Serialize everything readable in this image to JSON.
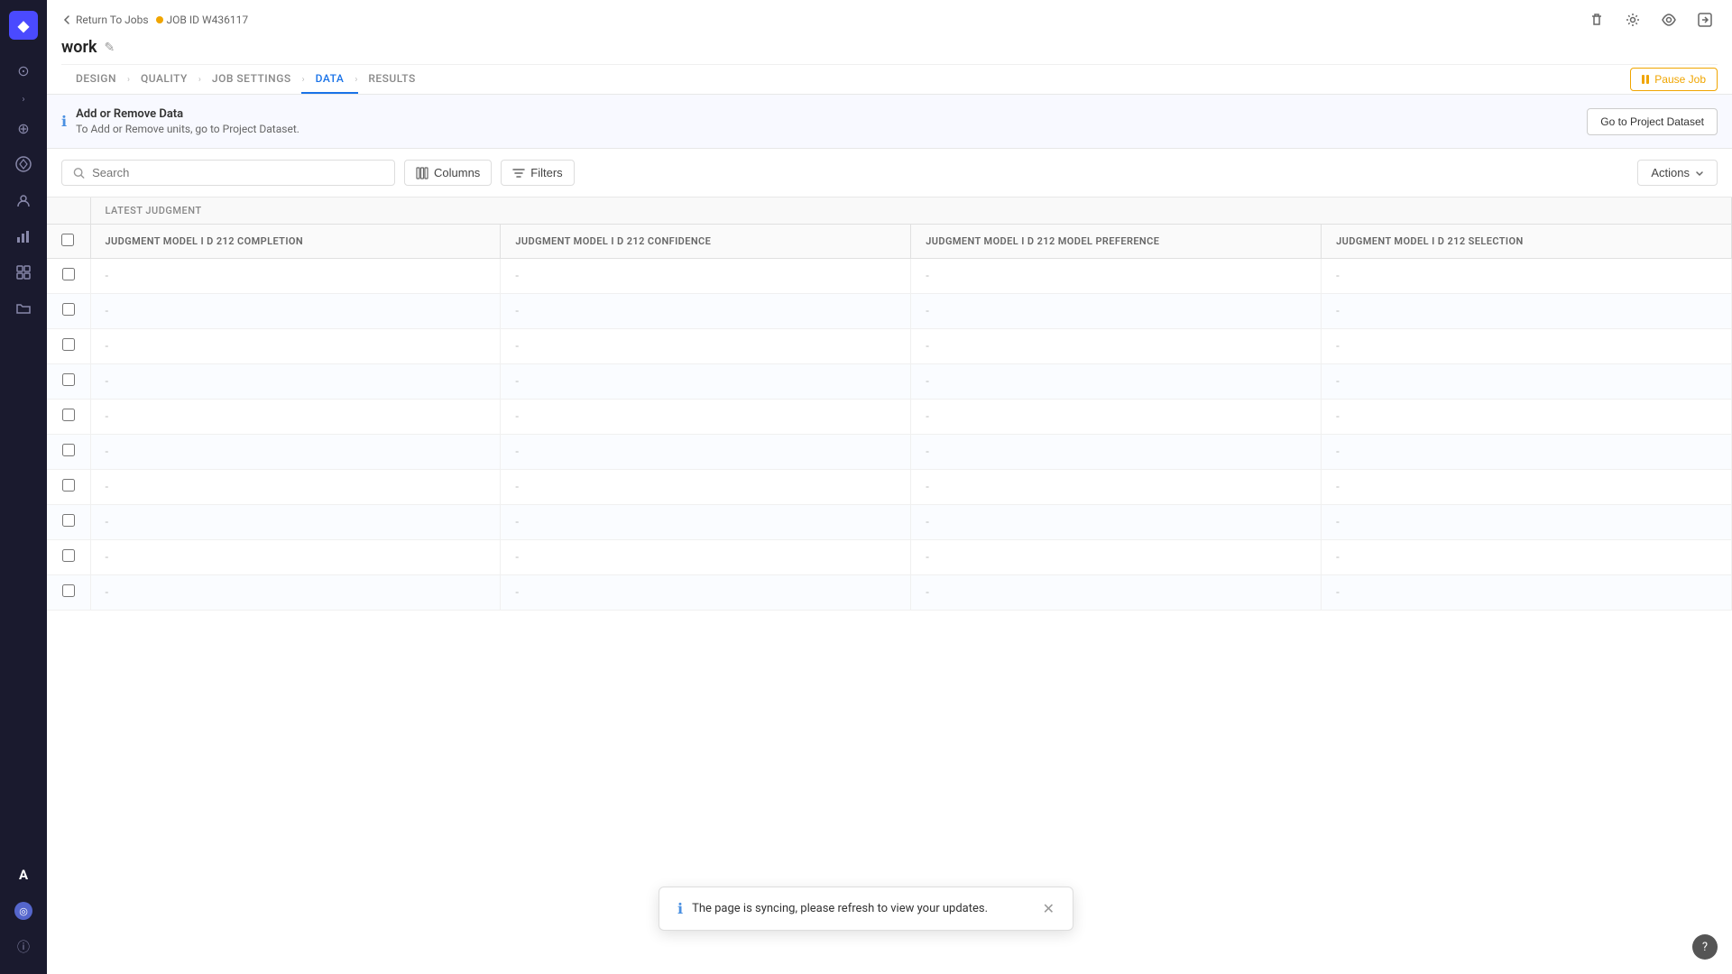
{
  "sidebar": {
    "logo_symbol": "◆",
    "icons": [
      {
        "name": "home-icon",
        "symbol": "⊙",
        "active": false
      },
      {
        "name": "expand-left-icon",
        "symbol": "›",
        "active": false
      },
      {
        "name": "globe-icon",
        "symbol": "⊕",
        "active": false
      },
      {
        "name": "data-icon",
        "symbol": "⊞",
        "active": false
      },
      {
        "name": "people-icon",
        "symbol": "⚇",
        "active": false
      },
      {
        "name": "chart-icon",
        "symbol": "▦",
        "active": false
      },
      {
        "name": "grid-icon",
        "symbol": "⊟",
        "active": false
      },
      {
        "name": "folder-icon",
        "symbol": "⊠",
        "active": false
      },
      {
        "name": "font-icon",
        "symbol": "A",
        "active": false
      },
      {
        "name": "user-icon",
        "symbol": "◎",
        "active": false
      },
      {
        "name": "info-bottom-icon",
        "symbol": "ⓘ",
        "active": false
      }
    ]
  },
  "topbar": {
    "back_label": "Return To Jobs",
    "job_id_label": "JOB ID W436117",
    "page_title": "work",
    "edit_icon": "✎",
    "icons": [
      {
        "name": "delete-icon",
        "symbol": "🗑"
      },
      {
        "name": "settings-icon",
        "symbol": "⚙"
      },
      {
        "name": "preview-icon",
        "symbol": "👁"
      },
      {
        "name": "share-icon",
        "symbol": "⬡"
      }
    ],
    "pause_btn_label": "Pause Job"
  },
  "nav": {
    "tabs": [
      {
        "label": "DESIGN",
        "active": false
      },
      {
        "label": "QUALITY",
        "active": false
      },
      {
        "label": "JOB SETTINGS",
        "active": false
      },
      {
        "label": "DATA",
        "active": true
      },
      {
        "label": "RESULTS",
        "active": false
      }
    ]
  },
  "info_bar": {
    "title": "Add or Remove Data",
    "subtitle": "To Add or Remove units, go to Project Dataset.",
    "button_label": "Go to Project Dataset"
  },
  "toolbar": {
    "search_placeholder": "Search",
    "columns_label": "Columns",
    "filters_label": "Filters",
    "actions_label": "Actions"
  },
  "table": {
    "latest_judgment_header": "LATEST JUDGMENT",
    "columns": [
      {
        "key": "completion",
        "label": "JUDGMENT MODEL I D 212 COMPLETION"
      },
      {
        "key": "confidence",
        "label": "JUDGMENT MODEL I D 212 CONFIDENCE"
      },
      {
        "key": "preference",
        "label": "JUDGMENT MODEL I D 212 MODEL PREFERENCE"
      },
      {
        "key": "selection",
        "label": "JUDGMENT MODEL I D 212 SELECTION"
      }
    ],
    "rows": [
      {
        "completion": "-",
        "confidence": "-",
        "preference": "-",
        "selection": "-"
      },
      {
        "completion": "-",
        "confidence": "-",
        "preference": "-",
        "selection": "-"
      },
      {
        "completion": "-",
        "confidence": "-",
        "preference": "-",
        "selection": "-"
      },
      {
        "completion": "-",
        "confidence": "-",
        "preference": "-",
        "selection": "-"
      },
      {
        "completion": "-",
        "confidence": "-",
        "preference": "-",
        "selection": "-"
      },
      {
        "completion": "-",
        "confidence": "-",
        "preference": "-",
        "selection": "-"
      },
      {
        "completion": "-",
        "confidence": "-",
        "preference": "-",
        "selection": "-"
      },
      {
        "completion": "-",
        "confidence": "-",
        "preference": "-",
        "selection": "-"
      },
      {
        "completion": "-",
        "confidence": "-",
        "preference": "-",
        "selection": "-"
      },
      {
        "completion": "-",
        "confidence": "-",
        "preference": "-",
        "selection": "-"
      }
    ]
  },
  "toast": {
    "message": "The page is syncing, please refresh to view your updates.",
    "close_symbol": "✕"
  },
  "help_symbol": "?"
}
